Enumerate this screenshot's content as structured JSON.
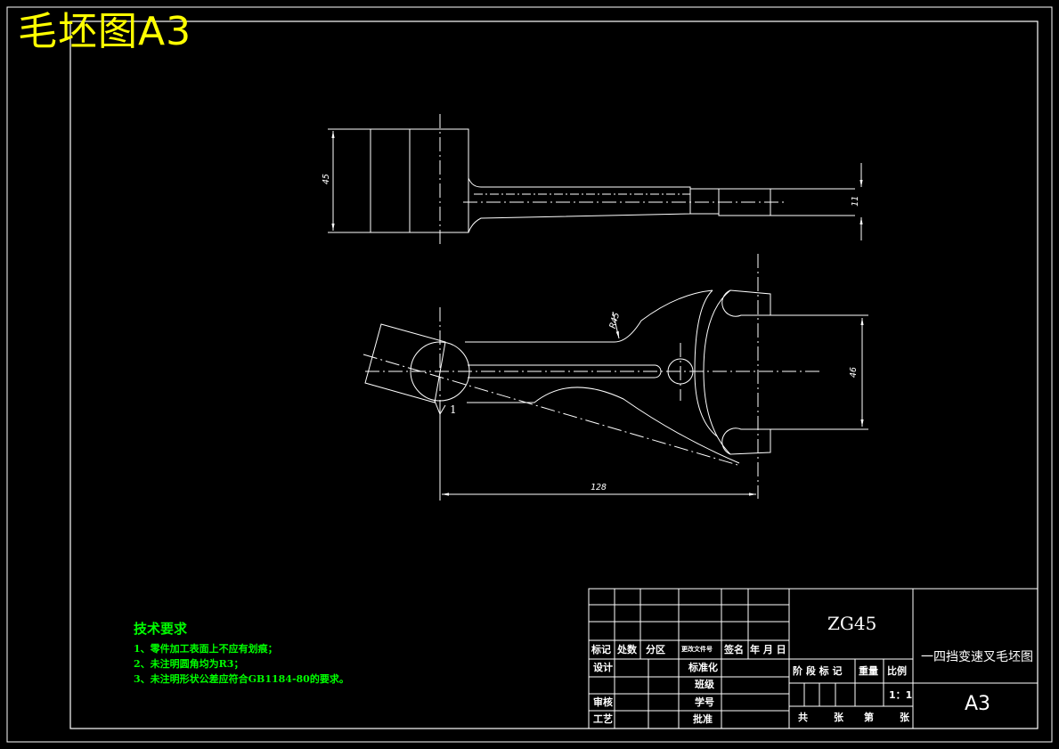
{
  "header": {
    "title": "毛坯图A3"
  },
  "dimensions": {
    "d45": "45",
    "d11": "11",
    "r45": "R45",
    "d46": "46",
    "d128": "128",
    "angle": "1"
  },
  "tech": {
    "heading": "技术要求",
    "lines": [
      "1、零件加工表面上不应有划痕；",
      "2、未注明圆角均为R3；",
      "3、未注明形状公差应符合GB1184-80的要求。"
    ]
  },
  "title_block": {
    "rev_headers": [
      "标记",
      "处数",
      "分区",
      "更改文件号",
      "签名",
      "年 月 日"
    ],
    "design": "设计",
    "standardize": "标准化",
    "class": "班级",
    "review": "审核",
    "student_id": "学号",
    "process": "工艺",
    "approve": "批准",
    "stage_mark": "阶 段 标 记",
    "weight": "重量",
    "scale": "比例",
    "scale_value": "1：1",
    "sheet_total": "共",
    "sheet_unit": "张",
    "sheet_num": "第",
    "sheet_unit2": "张",
    "material": "ZG45",
    "drawing_name": "一四挡变速叉毛坯图",
    "size": "A3"
  },
  "colors": {
    "frame": "#ffffff",
    "title": "#ffff00",
    "tech": "#00ff00"
  }
}
